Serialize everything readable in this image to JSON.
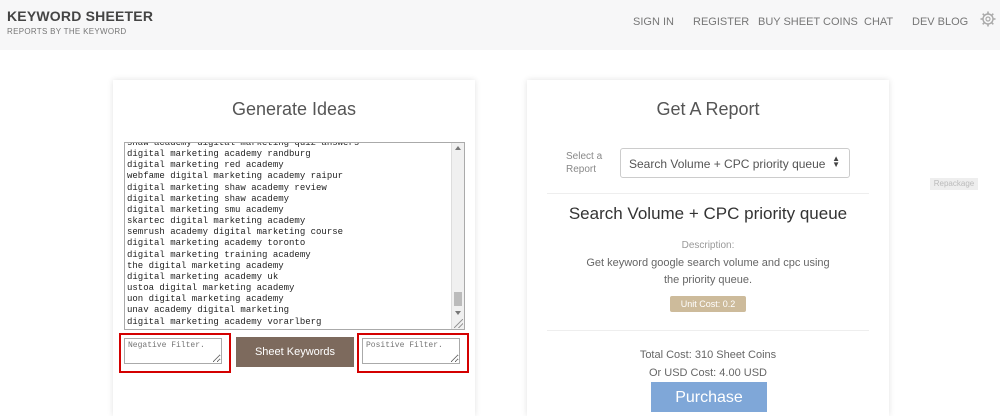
{
  "header": {
    "brand_title": "KEYWORD SHEETER",
    "brand_subtitle": "REPORTS BY THE KEYWORD",
    "nav": [
      {
        "label": "SIGN IN"
      },
      {
        "label": "REGISTER"
      },
      {
        "label": "BUY SHEET COINS"
      },
      {
        "label": "CHAT"
      },
      {
        "label": "DEV BLOG"
      }
    ],
    "settings_icon": "gear-icon"
  },
  "generate": {
    "title": "Generate Ideas",
    "keywords": [
      "shaw academy digital marketing quiz answers",
      "digital marketing academy randburg",
      "digital marketing red academy",
      "webfame digital marketing academy raipur",
      "digital marketing shaw academy review",
      "digital marketing shaw academy",
      "digital marketing smu academy",
      "skartec digital marketing academy",
      "semrush academy digital marketing course",
      "digital marketing academy toronto",
      "digital marketing training academy",
      "the digital marketing academy",
      "digital marketing academy uk",
      "ustoa digital marketing academy",
      "uon digital marketing academy",
      "unav academy digital marketing",
      "digital marketing academy vorarlberg"
    ],
    "negative_placeholder": "Negative Filter.",
    "positive_placeholder": "Positive Filter.",
    "sheet_button": "Sheet Keywords",
    "highlight_color": "#d40000",
    "button_color": "#7d6a5d"
  },
  "report": {
    "title": "Get A Report",
    "select_label": "Select a Report",
    "selected": "Search Volume + CPC priority queue",
    "report_name": "Search Volume + CPC priority queue",
    "description_label": "Description:",
    "description": "Get keyword google search volume and cpc using the priority queue.",
    "unit_cost": "Unit Cost: 0.2",
    "total_cost": "Total Cost: 310 Sheet Coins",
    "usd_cost": "Or USD Cost: 4.00 USD",
    "purchase_label": "Purchase",
    "purchase_color": "#7fa7d8"
  },
  "side_tag": "Repackage"
}
